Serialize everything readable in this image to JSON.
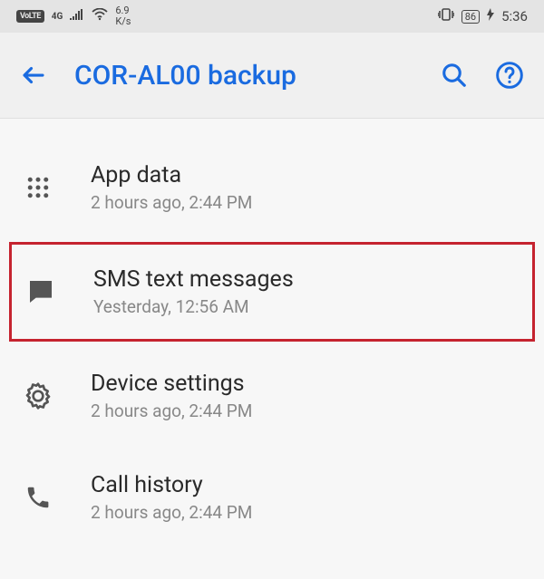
{
  "status_bar": {
    "volte": "VoLTE",
    "net_type": "4G",
    "speed_value": "6.9",
    "speed_unit": "K/s",
    "battery": "86",
    "time": "5:36"
  },
  "app_bar": {
    "title": "COR-AL00 backup"
  },
  "list": {
    "items": [
      {
        "icon": "apps-grid-icon",
        "title": "App data",
        "subtitle": "2 hours ago, 2:44 PM",
        "highlighted": false
      },
      {
        "icon": "sms-icon",
        "title": "SMS text messages",
        "subtitle": "Yesterday, 12:56 AM",
        "highlighted": true
      },
      {
        "icon": "settings-gear-icon",
        "title": "Device settings",
        "subtitle": "2 hours ago, 2:44 PM",
        "highlighted": false
      },
      {
        "icon": "phone-icon",
        "title": "Call history",
        "subtitle": "2 hours ago, 2:44 PM",
        "highlighted": false
      }
    ]
  },
  "colors": {
    "accent": "#1a6be0",
    "highlight_border": "#c5232f"
  }
}
